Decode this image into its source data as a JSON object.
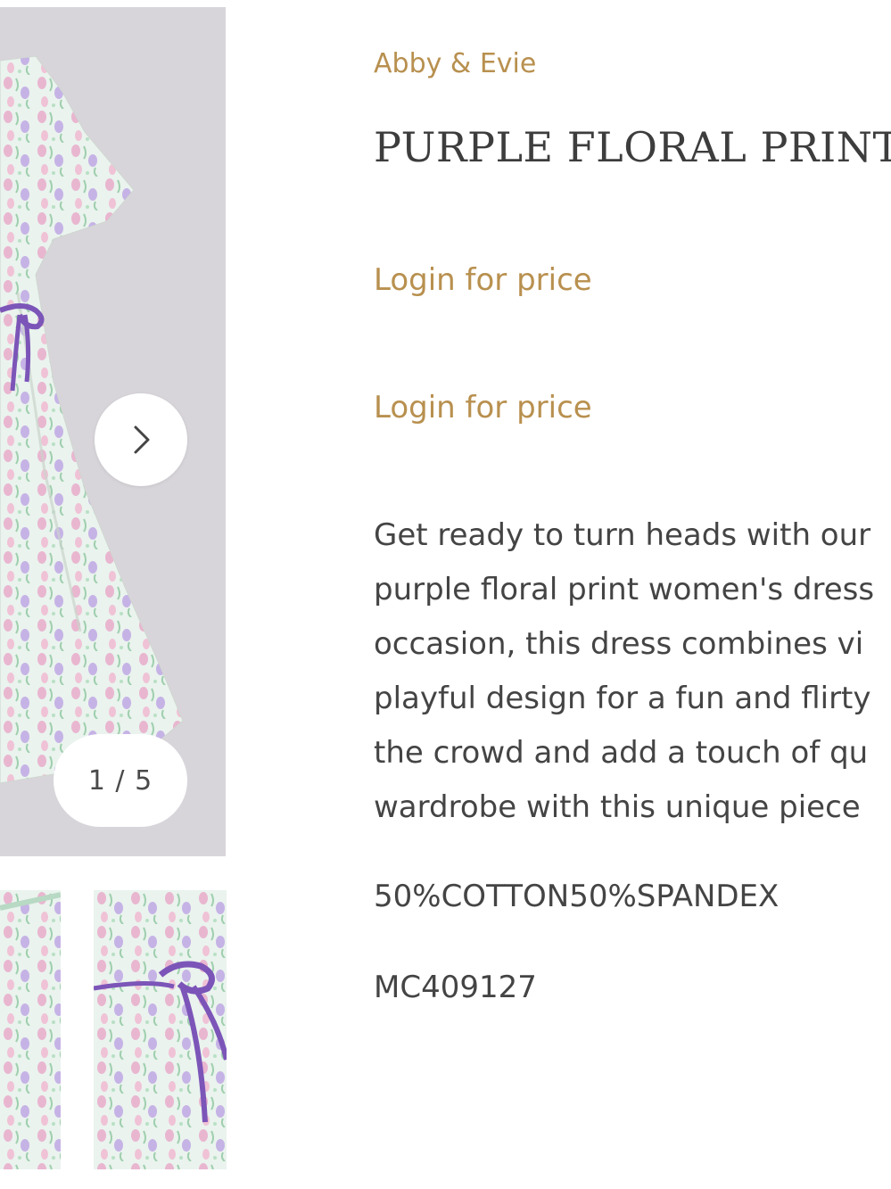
{
  "gallery": {
    "next_icon": "chevron-right-icon",
    "counter": "1 / 5"
  },
  "product": {
    "brand": "Abby & Evie",
    "title": "PURPLE FLORAL PRINT",
    "price_1": "Login for price",
    "price_2": "Login for price",
    "description_lines": [
      "Get ready to turn heads with our",
      "purple floral print women's dress",
      "occasion, this dress combines vi",
      "playful design for a fun and flirty",
      "the crowd and add a touch of qu",
      "wardrobe with this unique piece"
    ],
    "material": "50%COTTON50%SPANDEX",
    "sku": "MC409127"
  },
  "colors": {
    "accent": "#b8904f",
    "text": "#444444",
    "image_bg": "#d8d5da",
    "tie_purple": "#7c55b8"
  }
}
